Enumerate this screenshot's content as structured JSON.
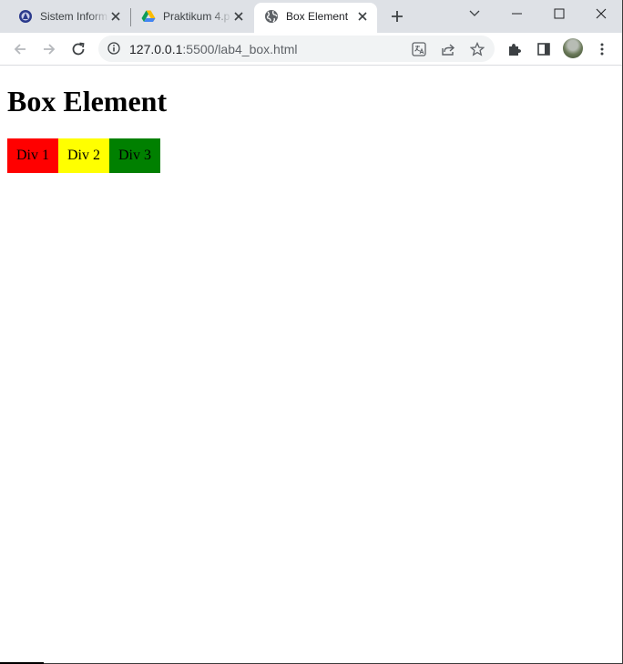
{
  "browser": {
    "tabs": [
      {
        "title": "Sistem Inform",
        "icon": "university-logo-icon",
        "active": false
      },
      {
        "title": "Praktikum 4.p",
        "icon": "google-drive-icon",
        "active": false
      },
      {
        "title": "Box Element",
        "icon": "globe-icon",
        "active": true
      }
    ],
    "address": {
      "host": "127.0.0.1",
      "rest": ":5500/lab4_box.html"
    }
  },
  "page": {
    "heading": "Box Element",
    "boxes": [
      {
        "label": "Div 1",
        "color": "#ff0000"
      },
      {
        "label": "Div 2",
        "color": "#ffff00"
      },
      {
        "label": "Div 3",
        "color": "#008000"
      }
    ]
  },
  "colors": {
    "tabstrip": "#dee1e6",
    "omnibox": "#f1f3f4"
  }
}
